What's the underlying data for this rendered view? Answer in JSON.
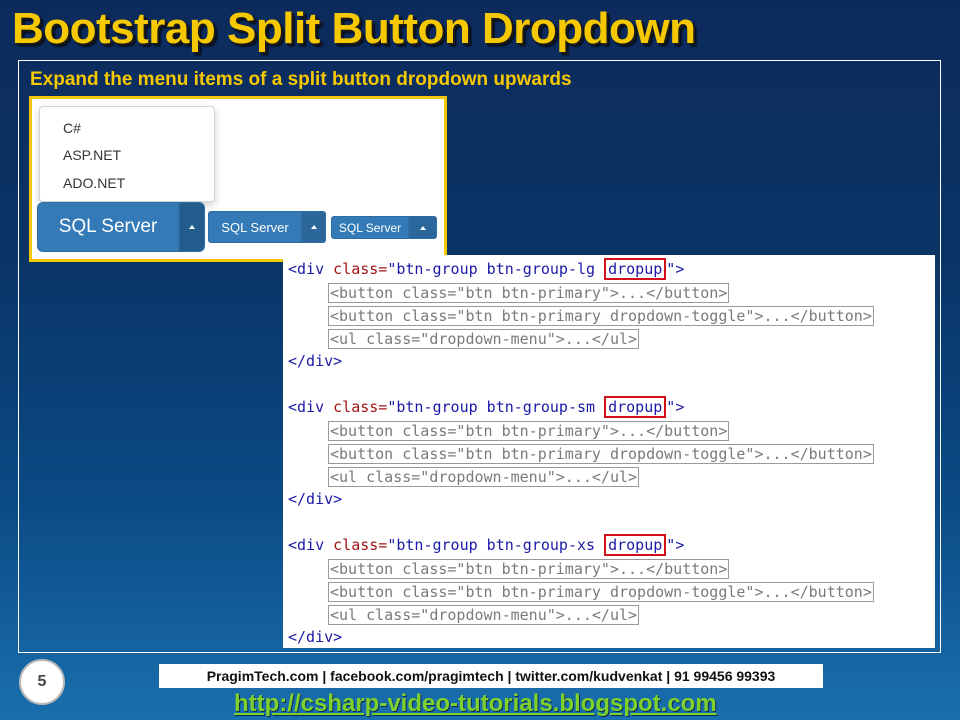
{
  "slide": {
    "title": "Bootstrap Split Button Dropdown",
    "subtitle": "Expand the menu items of a split button dropdown upwards",
    "number": "5"
  },
  "demo": {
    "menu_items": [
      "C#",
      "ASP.NET",
      "ADO.NET"
    ],
    "button_lg": "SQL Server",
    "button_sm": "SQL Server",
    "button_xs": "SQL Server"
  },
  "code_blocks": [
    {
      "open_prefix": "<div ",
      "attr": "class=",
      "value_start": "\"btn-group btn-group-lg ",
      "highlight": "dropup",
      "value_end": "\"",
      "close_bracket": ">",
      "child1": "<button class=\"btn btn-primary\">...</button>",
      "child2": "<button class=\"btn btn-primary dropdown-toggle\">...</button>",
      "child3": "<ul class=\"dropdown-menu\">...</ul>",
      "close": "</div>"
    },
    {
      "open_prefix": "<div ",
      "attr": "class=",
      "value_start": "\"btn-group btn-group-sm ",
      "highlight": "dropup",
      "value_end": "\"",
      "close_bracket": ">",
      "child1": "<button class=\"btn btn-primary\">...</button>",
      "child2": "<button class=\"btn btn-primary dropdown-toggle\">...</button>",
      "child3": "<ul class=\"dropdown-menu\">...</ul>",
      "close": "</div>"
    },
    {
      "open_prefix": "<div ",
      "attr": "class=",
      "value_start": "\"btn-group btn-group-xs ",
      "highlight": "dropup",
      "value_end": "\"",
      "close_bracket": ">",
      "child1": "<button class=\"btn btn-primary\">...</button>",
      "child2": "<button class=\"btn btn-primary dropdown-toggle\">...</button>",
      "child3": "<ul class=\"dropdown-menu\">...</ul>",
      "close": "</div>"
    }
  ],
  "footer": {
    "contact": "PragimTech.com | facebook.com/pragimtech | twitter.com/kudvenkat | 91 99456 99393",
    "link": "http://csharp-video-tutorials.blogspot.com"
  },
  "colors": {
    "title": "#f5c800",
    "primary_button": "#337ab7",
    "highlight_box": "#d0101a",
    "link": "#7dd12a"
  }
}
